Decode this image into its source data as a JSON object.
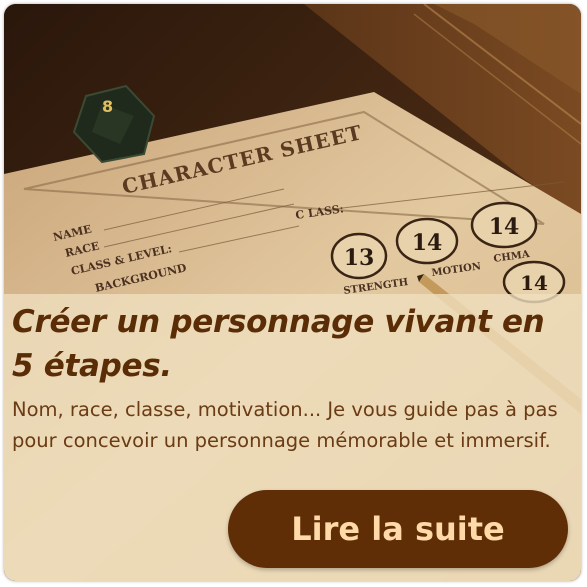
{
  "sheet": {
    "title": "CHARACTER SHEET",
    "fields": {
      "name": "NAME",
      "race": "RACE",
      "class_level": "CLASS & LEVEL:",
      "background": "BACKGROUND",
      "class": "C LASS:"
    },
    "stats": [
      "13",
      "14",
      "14",
      "14"
    ],
    "stat_labels": {
      "strength": "STRENGTH",
      "motion": "MOTION",
      "chma": "CHMA"
    },
    "die_face": "8"
  },
  "post": {
    "headline": "Créer un personnage vivant en 5 étapes.",
    "excerpt": "Nom, race, classe, motivation... Je vous guide pas à pas pour concevoir un personnage mémorable et immersif.",
    "cta_label": "Lire la suite"
  },
  "colors": {
    "headline": "#5a2d06",
    "body": "#6a3b14",
    "cta_bg": "#5f2e06",
    "cta_text": "#ffd9a8",
    "overlay": "#efdebe"
  }
}
